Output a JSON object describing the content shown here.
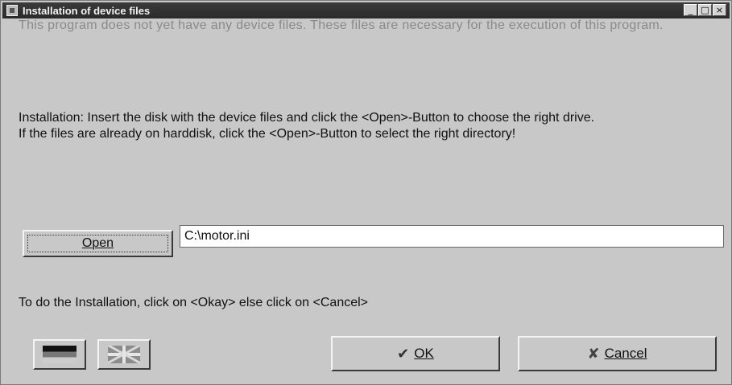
{
  "window": {
    "title": "Installation of device files",
    "controls": {
      "minimize": "_",
      "maximize": "□",
      "close": "×"
    }
  },
  "intro_text": "This program does not yet have any device files. These files are necessary for the execution of this program.",
  "install_text": {
    "line1": "Installation: Insert the disk with the device files and click the <Open>-Button to choose the right drive.",
    "line2": "If the files are already on harddisk, click the <Open>-Button to select the right directory!"
  },
  "open_button": {
    "label": "Open"
  },
  "path_field": {
    "value": "C:\\motor.ini"
  },
  "hint_text": "To do the Installation, click on <Okay> else click on <Cancel>",
  "ok_button": {
    "label": "OK",
    "icon": "check-icon"
  },
  "cancel_button": {
    "label": "Cancel",
    "icon": "x-icon"
  },
  "language_buttons": [
    {
      "icon": "german-flag-icon"
    },
    {
      "icon": "uk-flag-icon"
    }
  ]
}
